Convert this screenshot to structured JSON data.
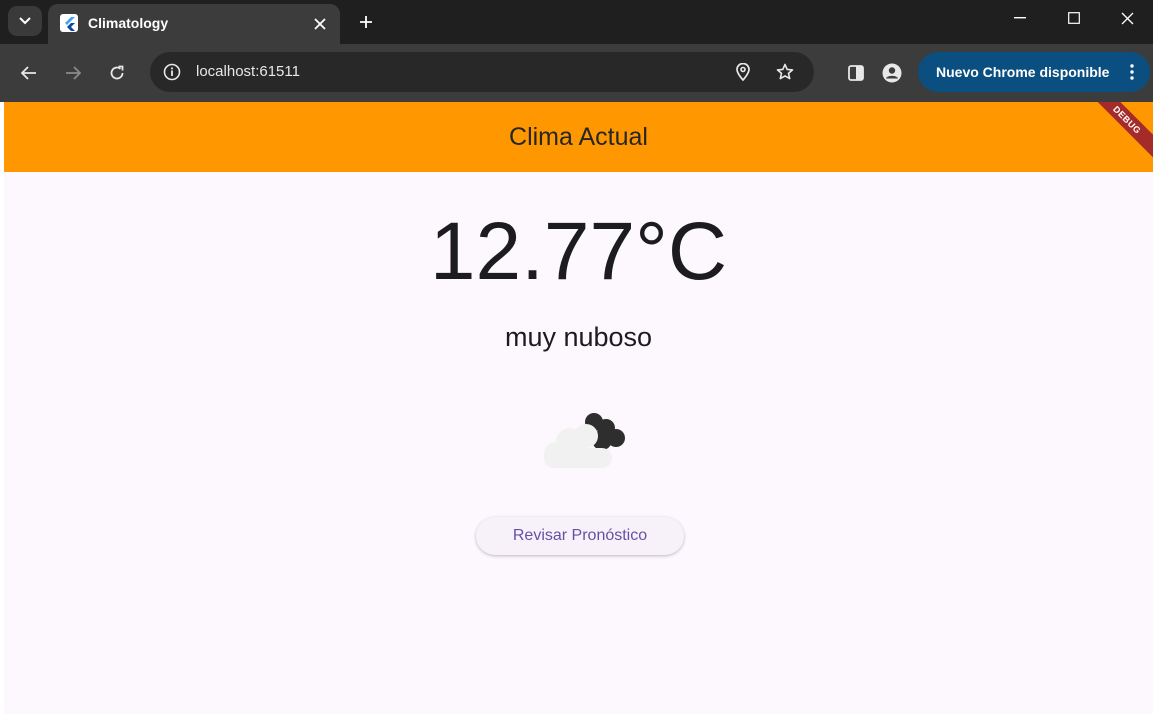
{
  "browser": {
    "tab": {
      "title": "Climatology",
      "favicon": "flutter-icon"
    },
    "address": {
      "url": "localhost:61511"
    },
    "update_button": {
      "label": "Nuevo Chrome disponible"
    }
  },
  "app": {
    "appbar": {
      "title": "Clima Actual",
      "debug_label": "DEBUG"
    },
    "weather": {
      "temperature": "12.77°C",
      "description": "muy nuboso",
      "icon": "broken-clouds-icon"
    },
    "forecast_button": {
      "label": "Revisar Pronóstico"
    }
  },
  "colors": {
    "appbar": "#ff9800",
    "background": "#fdf7fe",
    "button_text": "#6750a4",
    "debug_banner": "#a52a2a"
  }
}
